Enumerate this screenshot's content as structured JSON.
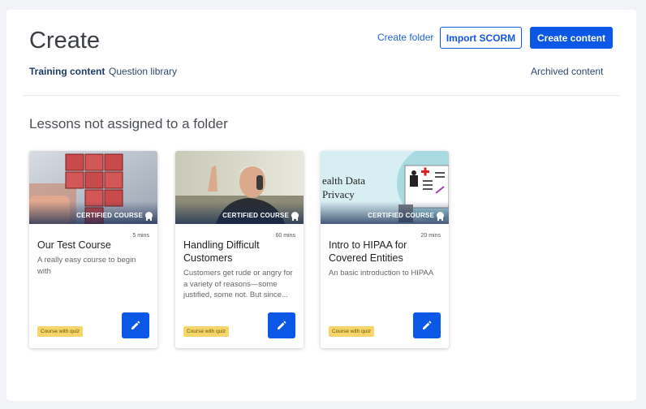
{
  "header": {
    "title": "Create",
    "create_folder": "Create folder",
    "import_scorm": "Import SCORM",
    "create_content": "Create content"
  },
  "tabs": [
    {
      "label": "Training content",
      "active": true
    },
    {
      "label": "Question library",
      "active": false
    }
  ],
  "archived_label": "Archived content",
  "section_title": "Lessons not assigned to a folder",
  "cards": [
    {
      "thumbnail": "puzzle-cubes-image",
      "badge_top": "CERTIFIED COURSE",
      "duration": "5 mins",
      "title": "Our Test Course",
      "description": "A really easy course to begin with",
      "tag": "Course with quiz"
    },
    {
      "thumbnail": "man-on-phone-image",
      "badge_top": "CERTIFIED COURSE",
      "duration": "60 mins",
      "title": "Handling Difficult Customers",
      "description": "Customers get rude or angry for a variety of reasons—some justified, some not. But since...",
      "tag": "Course with quiz"
    },
    {
      "thumbnail": "health-data-privacy-image",
      "thumbnail_text": "ealth Data\nPrivacy",
      "badge_top": "CERTIFIED COURSE",
      "duration": "20 mins",
      "title": "Intro to HIPAA for Covered Entities",
      "description": "An basic introduction to HIPAA",
      "tag": "Course with quiz"
    }
  ],
  "colors": {
    "primary": "#0b57e6",
    "tag_bg": "#f6d66a",
    "page_bg": "#f1f3f6"
  }
}
